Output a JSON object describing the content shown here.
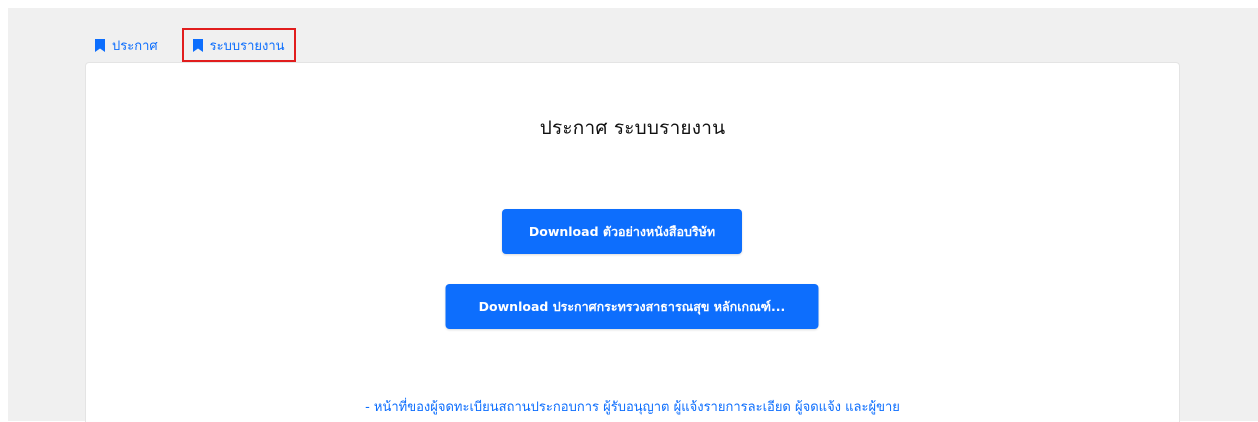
{
  "tabs": [
    {
      "label": "ประกาศ",
      "icon": "bookmark-icon",
      "active": false
    },
    {
      "label": "ระบบรายงาน",
      "icon": "bookmark-icon",
      "active": true
    }
  ],
  "card": {
    "title": "ประกาศ ระบบรายงาน",
    "buttons": [
      {
        "label": "Download ตัวอย่างหนังสือบริษัท"
      },
      {
        "label": "Download ประกาศกระทรวงสาธารณสุข หลักเกณฑ์..."
      }
    ],
    "info_link": "- หน้าที่ของผู้จดทะเบียนสถานประกอบการ ผู้รับอนุญาต ผู้แจ้งรายการละเอียด ผู้จดแจ้ง และผู้ขาย"
  },
  "colors": {
    "accent": "#0d6efd",
    "highlight_border": "#e11d1d",
    "page_background": "#f0f0f0"
  }
}
